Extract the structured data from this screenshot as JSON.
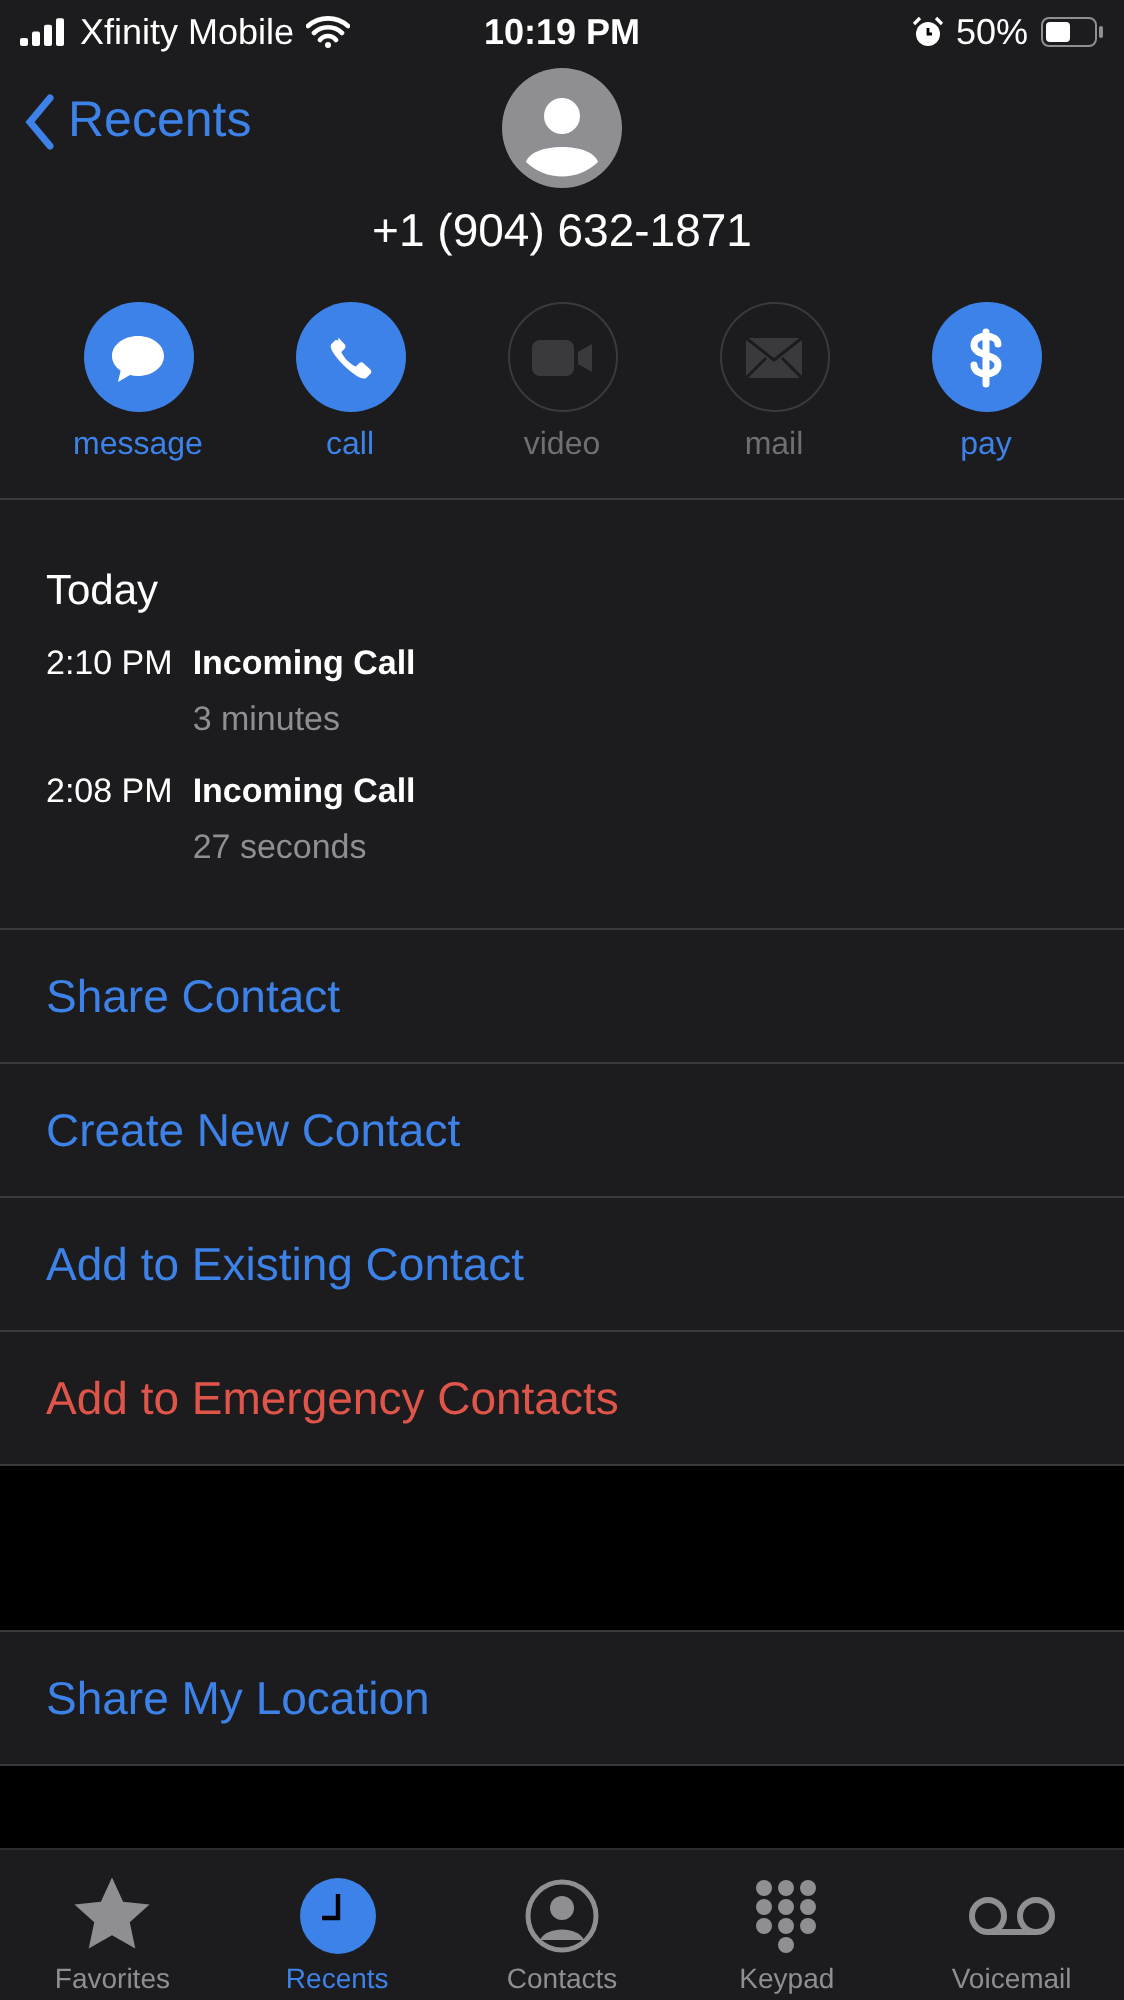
{
  "status_bar": {
    "carrier": "Xfinity Mobile",
    "time": "10:19 PM",
    "battery": "50%"
  },
  "nav": {
    "back": "Recents"
  },
  "contact": {
    "number": "+1 (904) 632-1871"
  },
  "actions": [
    {
      "kind": "message",
      "label": "message",
      "enabled": true
    },
    {
      "kind": "call",
      "label": "call",
      "enabled": true
    },
    {
      "kind": "video",
      "label": "video",
      "enabled": false
    },
    {
      "kind": "mail",
      "label": "mail",
      "enabled": false
    },
    {
      "kind": "pay",
      "label": "pay",
      "enabled": true
    }
  ],
  "history": {
    "heading": "Today",
    "calls": [
      {
        "time": "2:10 PM",
        "type": "Incoming Call",
        "duration": "3 minutes"
      },
      {
        "time": "2:08 PM",
        "type": "Incoming Call",
        "duration": "27 seconds"
      }
    ]
  },
  "options": [
    {
      "label": "Share Contact",
      "kind": "normal"
    },
    {
      "label": "Create New Contact",
      "kind": "normal"
    },
    {
      "label": "Add to Existing Contact",
      "kind": "normal"
    },
    {
      "label": "Add to Emergency Contacts",
      "kind": "danger"
    }
  ],
  "location": {
    "label": "Share My Location"
  },
  "tab_bar": [
    {
      "kind": "favorites",
      "label": "Favorites",
      "selected": false
    },
    {
      "kind": "recents",
      "label": "Recents",
      "selected": true
    },
    {
      "kind": "contacts",
      "label": "Contacts",
      "selected": false
    },
    {
      "kind": "keypad",
      "label": "Keypad",
      "selected": false
    },
    {
      "kind": "voicemail",
      "label": "Voicemail",
      "selected": false
    }
  ]
}
